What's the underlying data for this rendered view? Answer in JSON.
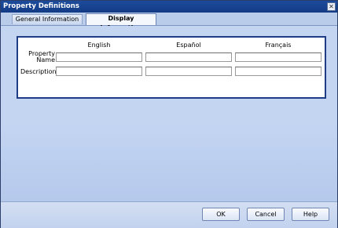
{
  "window": {
    "title": "Property Definitions",
    "close_icon": "close-icon",
    "close_glyph": "✕"
  },
  "tabs": [
    {
      "label": "General Information",
      "active": false
    },
    {
      "label": "Display Information",
      "active": true
    }
  ],
  "form": {
    "columns": [
      "English",
      "Español",
      "Français"
    ],
    "rows": [
      {
        "label_line1": "Property",
        "label_line2": "Name",
        "values": [
          "",
          "",
          ""
        ]
      },
      {
        "label_line1": "Description",
        "label_line2": "",
        "values": [
          "",
          "",
          ""
        ]
      }
    ]
  },
  "buttons": {
    "ok": "OK",
    "cancel": "Cancel",
    "help": "Help"
  }
}
